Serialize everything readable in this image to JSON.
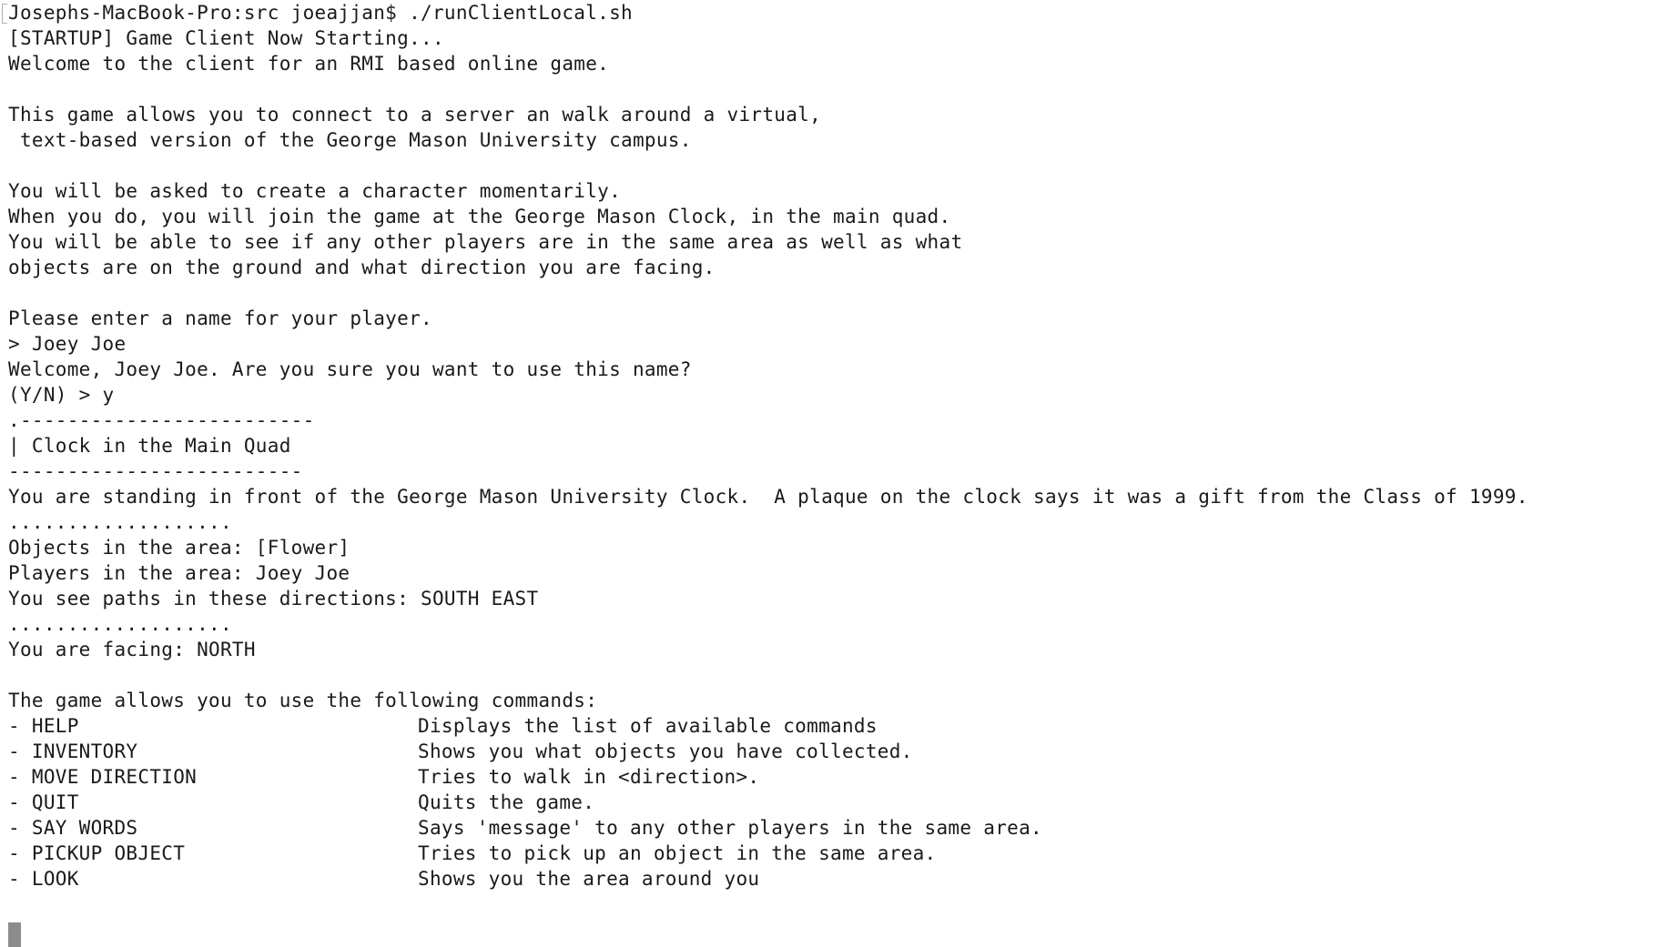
{
  "terminal": {
    "lines_top": [
      "Josephs-MacBook-Pro:src joeajjan$ ./runClientLocal.sh",
      "[STARTUP] Game Client Now Starting...",
      "Welcome to the client for an RMI based online game.",
      "",
      "This game allows you to connect to a server an walk around a virtual,",
      " text-based version of the George Mason University campus.",
      "",
      "You will be asked to create a character momentarily.",
      "When you do, you will join the game at the George Mason Clock, in the main quad.",
      "You will be able to see if any other players are in the same area as well as what",
      "objects are on the ground and what direction you are facing.",
      "",
      "Please enter a name for your player.",
      "> Joey Joe",
      "Welcome, Joey Joe. Are you sure you want to use this name?",
      "(Y/N) > y",
      ".-------------------------",
      "| Clock in the Main Quad",
      "-------------------------",
      "You are standing in front of the George Mason University Clock.  A plaque on the clock says it was a gift from the Class of 1999.",
      "...................",
      "Objects in the area: [Flower]",
      "Players in the area: Joey Joe",
      "You see paths in these directions: SOUTH EAST",
      "...................",
      "You are facing: NORTH",
      "",
      "The game allows you to use the following commands:"
    ],
    "commands": [
      {
        "name": "- HELP",
        "desc": "Displays the list of available commands"
      },
      {
        "name": "- INVENTORY",
        "desc": "Shows you what objects you have collected."
      },
      {
        "name": "- MOVE DIRECTION",
        "desc": "Tries to walk in <direction>."
      },
      {
        "name": "- QUIT",
        "desc": "Quits the game."
      },
      {
        "name": "- SAY WORDS",
        "desc": "Says 'message' to any other players in the same area."
      },
      {
        "name": "- PICKUP OBJECT",
        "desc": "Tries to pick up an object in the same area."
      },
      {
        "name": "- LOOK",
        "desc": "Shows you the area around you"
      }
    ],
    "colors": {
      "background": "#ffffff",
      "text": "#1a1a1a",
      "cursor": "#8c8c8c"
    }
  }
}
